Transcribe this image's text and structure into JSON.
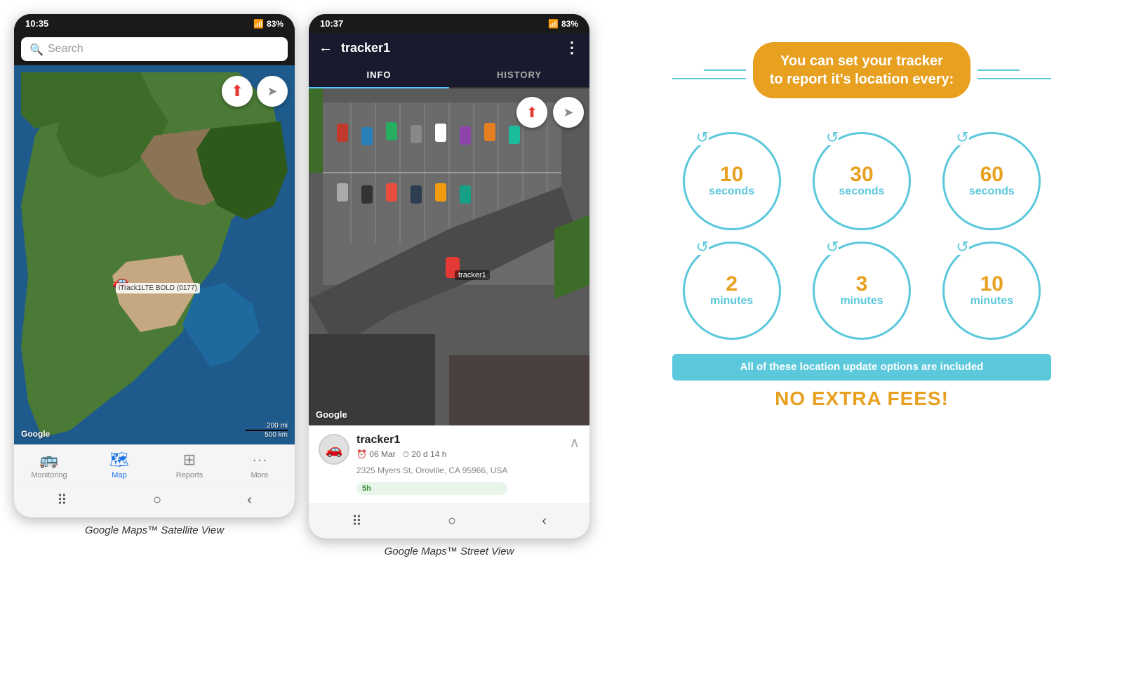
{
  "phone1": {
    "status_time": "10:35",
    "status_signal": "▲▲▲",
    "status_battery": "83%",
    "search_placeholder": "Search",
    "car_label": "iTrack1LTE BOLD (0177)",
    "google_logo": "Google",
    "scale_200mi": "200 mi",
    "scale_500km": "500 km",
    "nav_items": [
      {
        "icon": "🚌",
        "label": "Monitoring",
        "active": false
      },
      {
        "icon": "🗺",
        "label": "Map",
        "active": true
      },
      {
        "icon": "⊞",
        "label": "Reports",
        "active": false
      },
      {
        "icon": "•••",
        "label": "More",
        "active": false
      }
    ],
    "caption": "Google Maps™ Satellite View"
  },
  "phone2": {
    "status_time": "10:37",
    "status_signal": "▲▲▲",
    "status_battery": "83%",
    "back_arrow": "←",
    "tracker_title": "tracker1",
    "more_icon": "⋮",
    "tabs": [
      {
        "label": "INFO",
        "active": true
      },
      {
        "label": "HISTORY",
        "active": false
      }
    ],
    "google_logo": "Google",
    "tracker_name": "tracker1",
    "tracker_date": "06 Mar",
    "tracker_duration": "20 d 14 h",
    "tracker_address": "2325 Myers St, Oroville, CA 95966, USA",
    "duration_badge": "5h",
    "caption": "Google Maps™ Street View"
  },
  "promo": {
    "title_line1": "You can set your tracker",
    "title_line2": "to report it's location every:",
    "intervals": [
      {
        "number": "10",
        "unit": "seconds"
      },
      {
        "number": "30",
        "unit": "seconds"
      },
      {
        "number": "60",
        "unit": "seconds"
      },
      {
        "number": "2",
        "unit": "minutes"
      },
      {
        "number": "3",
        "unit": "minutes"
      },
      {
        "number": "10",
        "unit": "minutes"
      }
    ],
    "included_text": "All of these location update options are included",
    "no_fees_text": "NO EXTRA FEES!",
    "accent_color": "#e8a020",
    "teal_color": "#5bc8dc"
  }
}
